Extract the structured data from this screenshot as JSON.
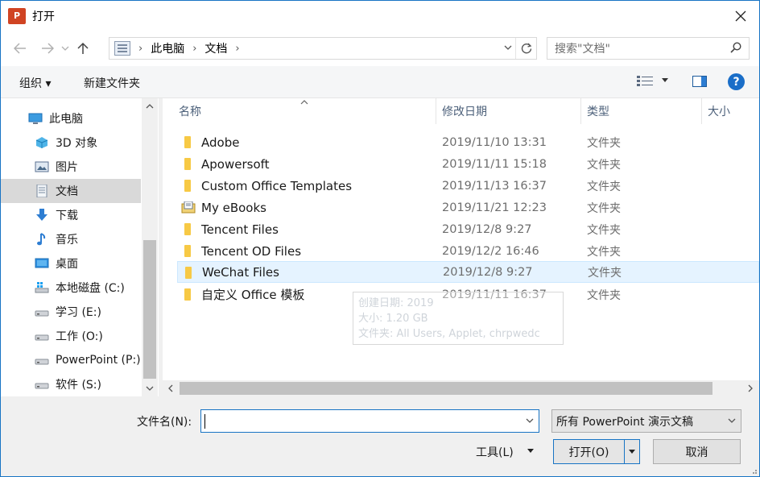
{
  "window": {
    "title": "打开",
    "app_icon": "powerpoint-icon"
  },
  "nav": {
    "breadcrumb": [
      "此电脑",
      "文档"
    ],
    "search_placeholder": "搜索\"文档\""
  },
  "toolbar": {
    "organize": "组织 ▾",
    "new_folder": "新建文件夹"
  },
  "sidebar": {
    "items": [
      {
        "label": "此电脑",
        "icon": "computer-icon"
      },
      {
        "label": "3D 对象",
        "icon": "3d-objects-icon"
      },
      {
        "label": "图片",
        "icon": "pictures-icon"
      },
      {
        "label": "文档",
        "icon": "documents-icon",
        "selected": true
      },
      {
        "label": "下载",
        "icon": "downloads-icon"
      },
      {
        "label": "音乐",
        "icon": "music-icon"
      },
      {
        "label": "桌面",
        "icon": "desktop-icon"
      },
      {
        "label": "本地磁盘 (C:)",
        "icon": "windows-drive-icon"
      },
      {
        "label": "学习 (E:)",
        "icon": "drive-icon"
      },
      {
        "label": "工作 (O:)",
        "icon": "drive-icon"
      },
      {
        "label": "PowerPoint (P:)",
        "icon": "drive-icon"
      },
      {
        "label": "软件 (S:)",
        "icon": "drive-icon"
      }
    ]
  },
  "columns": {
    "name": "名称",
    "date": "修改日期",
    "type": "类型",
    "size": "大小"
  },
  "files": [
    {
      "name": "Adobe",
      "date": "2019/11/10 13:31",
      "type": "文件夹",
      "icon": "folder-icon"
    },
    {
      "name": "Apowersoft",
      "date": "2019/11/11 15:18",
      "type": "文件夹",
      "icon": "folder-icon"
    },
    {
      "name": "Custom Office Templates",
      "date": "2019/11/13 16:37",
      "type": "文件夹",
      "icon": "folder-icon"
    },
    {
      "name": "My eBooks",
      "date": "2019/11/21 12:23",
      "type": "文件夹",
      "icon": "ebook-folder-icon"
    },
    {
      "name": "Tencent Files",
      "date": "2019/12/8 9:27",
      "type": "文件夹",
      "icon": "folder-icon"
    },
    {
      "name": "Tencent OD Files",
      "date": "2019/12/2 16:46",
      "type": "文件夹",
      "icon": "folder-icon"
    },
    {
      "name": "WeChat Files",
      "date": "2019/12/8 9:27",
      "type": "文件夹",
      "icon": "folder-icon",
      "hovered": true
    },
    {
      "name": "自定义 Office 模板",
      "date": "2019/11/11 16:37",
      "type": "文件夹",
      "icon": "folder-icon"
    }
  ],
  "tooltip": {
    "line1": "创建日期: 2019",
    "line2": "大小: 1.20 GB",
    "line3": "文件夹: All Users, Applet, chrpwedc"
  },
  "bottom": {
    "filename_label": "文件名(N):",
    "filename_value": "",
    "filter_value": "所有 PowerPoint 演示文稿",
    "tools_label": "工具(L)",
    "open_label": "打开(O)",
    "cancel_label": "取消"
  },
  "colors": {
    "accent": "#1874c4",
    "folder": "#f7c945",
    "hover_row": "#e5f3ff",
    "selected_nav": "#d9d9d9"
  }
}
